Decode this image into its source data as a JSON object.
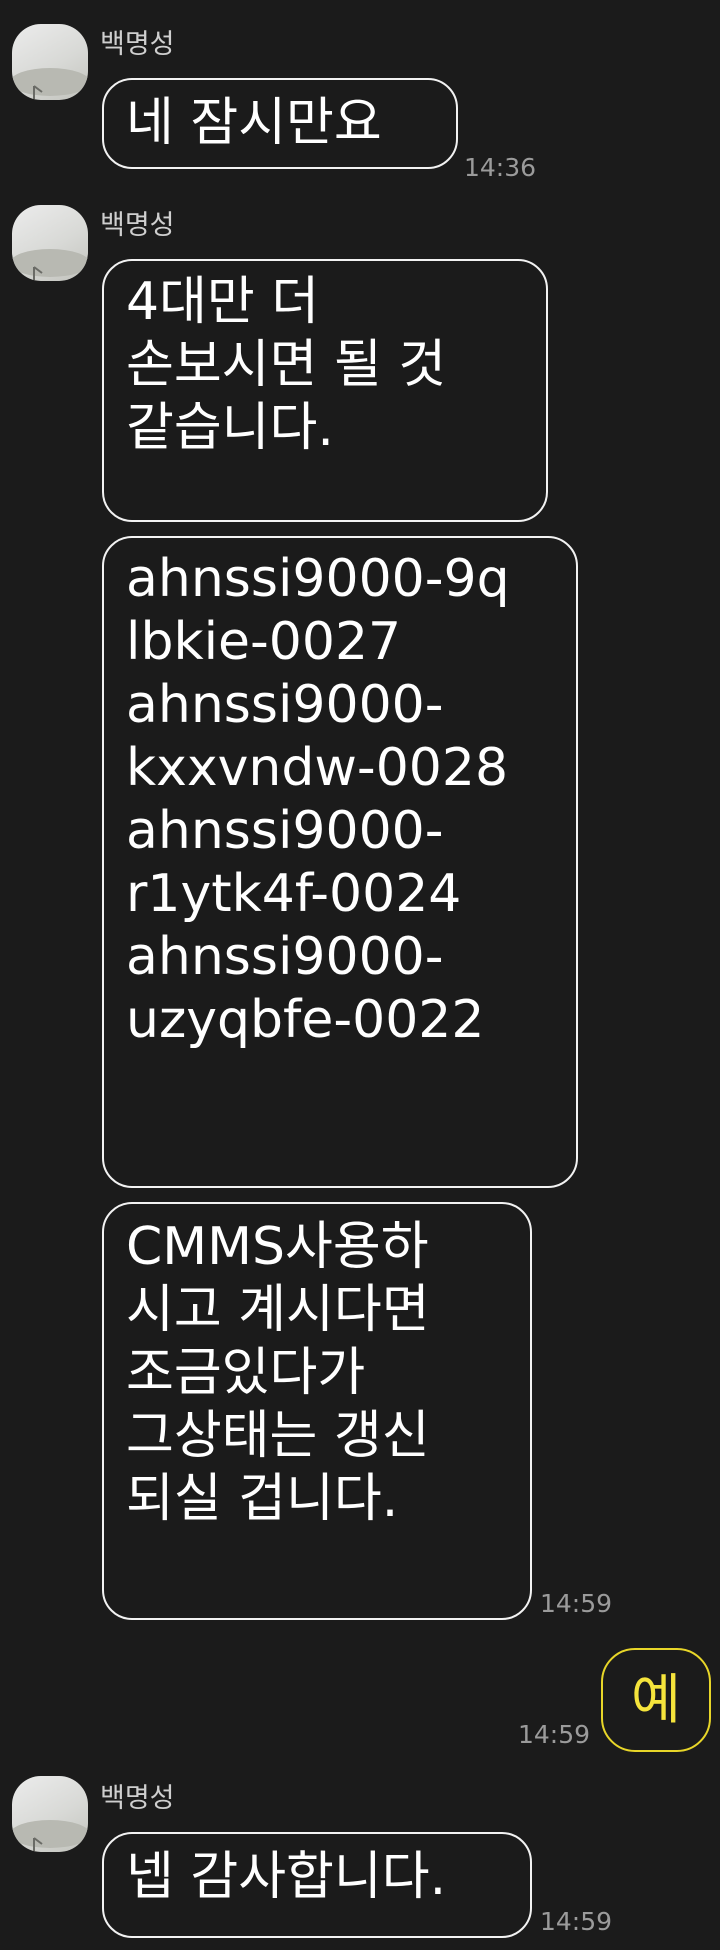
{
  "messages": [
    {
      "sender": "백명성",
      "bubbles": [
        {
          "lines": [
            "네 잠시만요"
          ],
          "time": "14:36"
        }
      ]
    },
    {
      "sender": "백명성",
      "bubbles": [
        {
          "lines": [
            "4대만 더",
            "손보시면 될 것",
            "같습니다."
          ]
        },
        {
          "lines": [
            "ahnssi9000-9q",
            "lbkie-0027",
            "ahnssi9000-",
            "kxxvndw-0028",
            "ahnssi9000-",
            "r1ytk4f-0024",
            "ahnssi9000-",
            "uzyqbfe-0022"
          ]
        },
        {
          "lines": [
            "CMMS사용하",
            "시고 계시다면",
            "조금있다가",
            "그상태는 갱신",
            "되실 겁니다."
          ],
          "time": "14:59"
        }
      ]
    },
    {
      "mine": true,
      "text": "예",
      "time": "14:59"
    },
    {
      "sender": "백명성",
      "bubbles": [
        {
          "lines": [
            "넵 감사합니다."
          ],
          "time": "14:59"
        }
      ]
    }
  ],
  "colors": {
    "background": "#1b1b1b",
    "incoming_border": "#f2f2f2",
    "outgoing_border": "#e8d629",
    "outgoing_text": "#f5e43c",
    "timestamp": "#9b9b9b"
  },
  "icons": [
    "avatar-photo"
  ]
}
